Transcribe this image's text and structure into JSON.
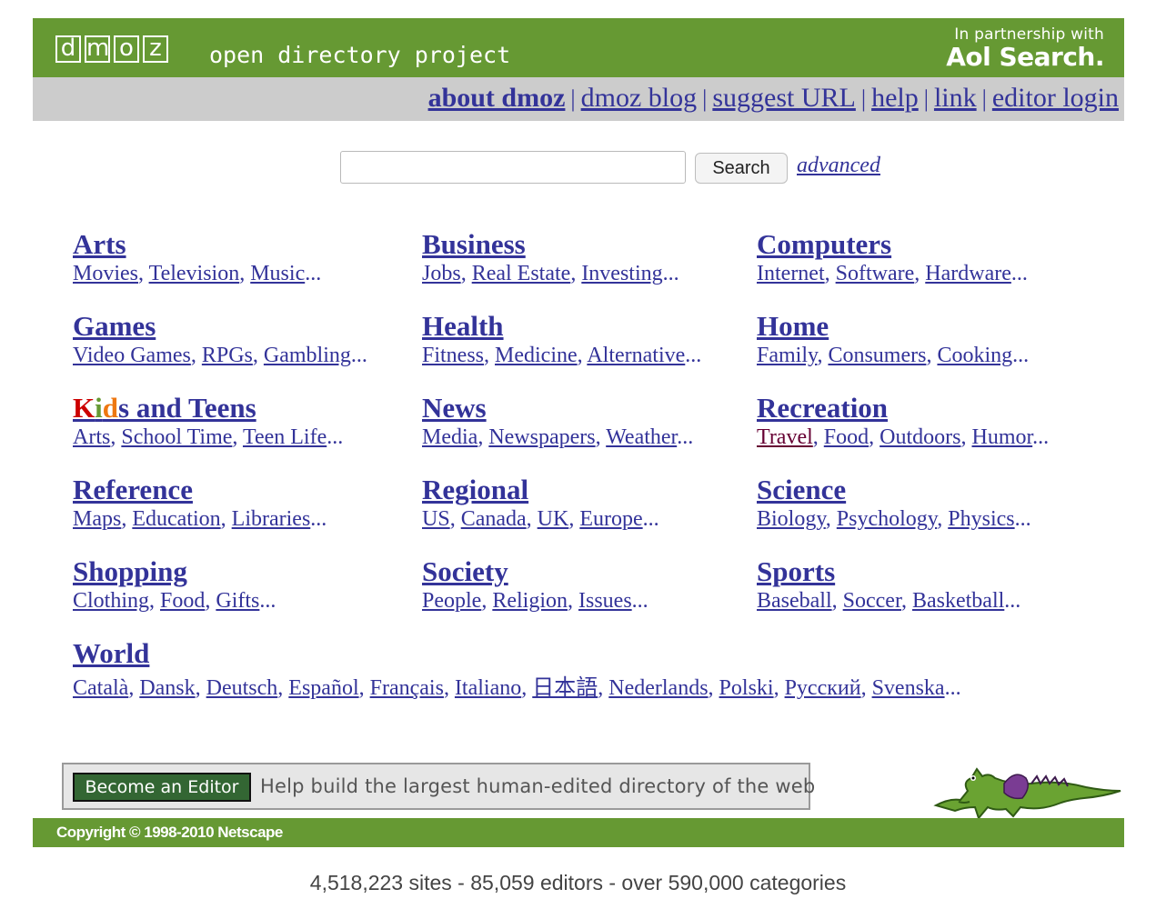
{
  "header": {
    "logo_letters": [
      "d",
      "m",
      "o",
      "z"
    ],
    "logo_subtitle": "open directory project",
    "partner_line1": "In partnership with",
    "partner_line2": "Aol Search.",
    "brand_color": "#669933"
  },
  "nav": {
    "items": [
      "about dmoz",
      "dmoz blog",
      "suggest URL",
      "help",
      "link",
      "editor login"
    ],
    "separator": "|"
  },
  "search": {
    "value": "",
    "button_label": "Search",
    "advanced_label": "advanced"
  },
  "categories": [
    {
      "title": "Arts",
      "subs": [
        "Movies",
        "Television",
        "Music"
      ]
    },
    {
      "title": "Business",
      "subs": [
        "Jobs",
        "Real Estate",
        "Investing"
      ]
    },
    {
      "title": "Computers",
      "subs": [
        "Internet",
        "Software",
        "Hardware"
      ]
    },
    {
      "title": "Games",
      "subs": [
        "Video Games",
        "RPGs",
        "Gambling"
      ]
    },
    {
      "title": "Health",
      "subs": [
        "Fitness",
        "Medicine",
        "Alternative"
      ]
    },
    {
      "title": "Home",
      "subs": [
        "Family",
        "Consumers",
        "Cooking"
      ]
    },
    {
      "title_parts": [
        "K",
        "i",
        "d",
        "s and Teens"
      ],
      "subs": [
        "Arts",
        "School Time",
        "Teen Life"
      ]
    },
    {
      "title": "News",
      "subs": [
        "Media",
        "Newspapers",
        "Weather"
      ]
    },
    {
      "title": "Recreation",
      "subs": [
        "Travel",
        "Food",
        "Outdoors",
        "Humor"
      ]
    },
    {
      "title": "Reference",
      "subs": [
        "Maps",
        "Education",
        "Libraries"
      ]
    },
    {
      "title": "Regional",
      "subs": [
        "US",
        "Canada",
        "UK",
        "Europe"
      ]
    },
    {
      "title": "Science",
      "subs": [
        "Biology",
        "Psychology",
        "Physics"
      ]
    },
    {
      "title": "Shopping",
      "subs": [
        "Clothing",
        "Food",
        "Gifts"
      ]
    },
    {
      "title": "Society",
      "subs": [
        "People",
        "Religion",
        "Issues"
      ]
    },
    {
      "title": "Sports",
      "subs": [
        "Baseball",
        "Soccer",
        "Basketball"
      ]
    }
  ],
  "world": {
    "title": "World",
    "subs": [
      "Català",
      "Dansk",
      "Deutsch",
      "Español",
      "Français",
      "Italiano",
      "日本語",
      "Nederlands",
      "Polski",
      "Русский",
      "Svenska"
    ]
  },
  "ellipsis": "...",
  "comma": ",",
  "editor": {
    "button_label": "Become an Editor",
    "text": "Help build the largest human-edited directory of the web"
  },
  "footer": {
    "copyright": "Copyright © 1998-2010 Netscape"
  },
  "stats": "4,518,223 sites - 85,059 editors - over 590,000 categories",
  "icons": {
    "mascot": "dmoz-dragon-icon"
  }
}
